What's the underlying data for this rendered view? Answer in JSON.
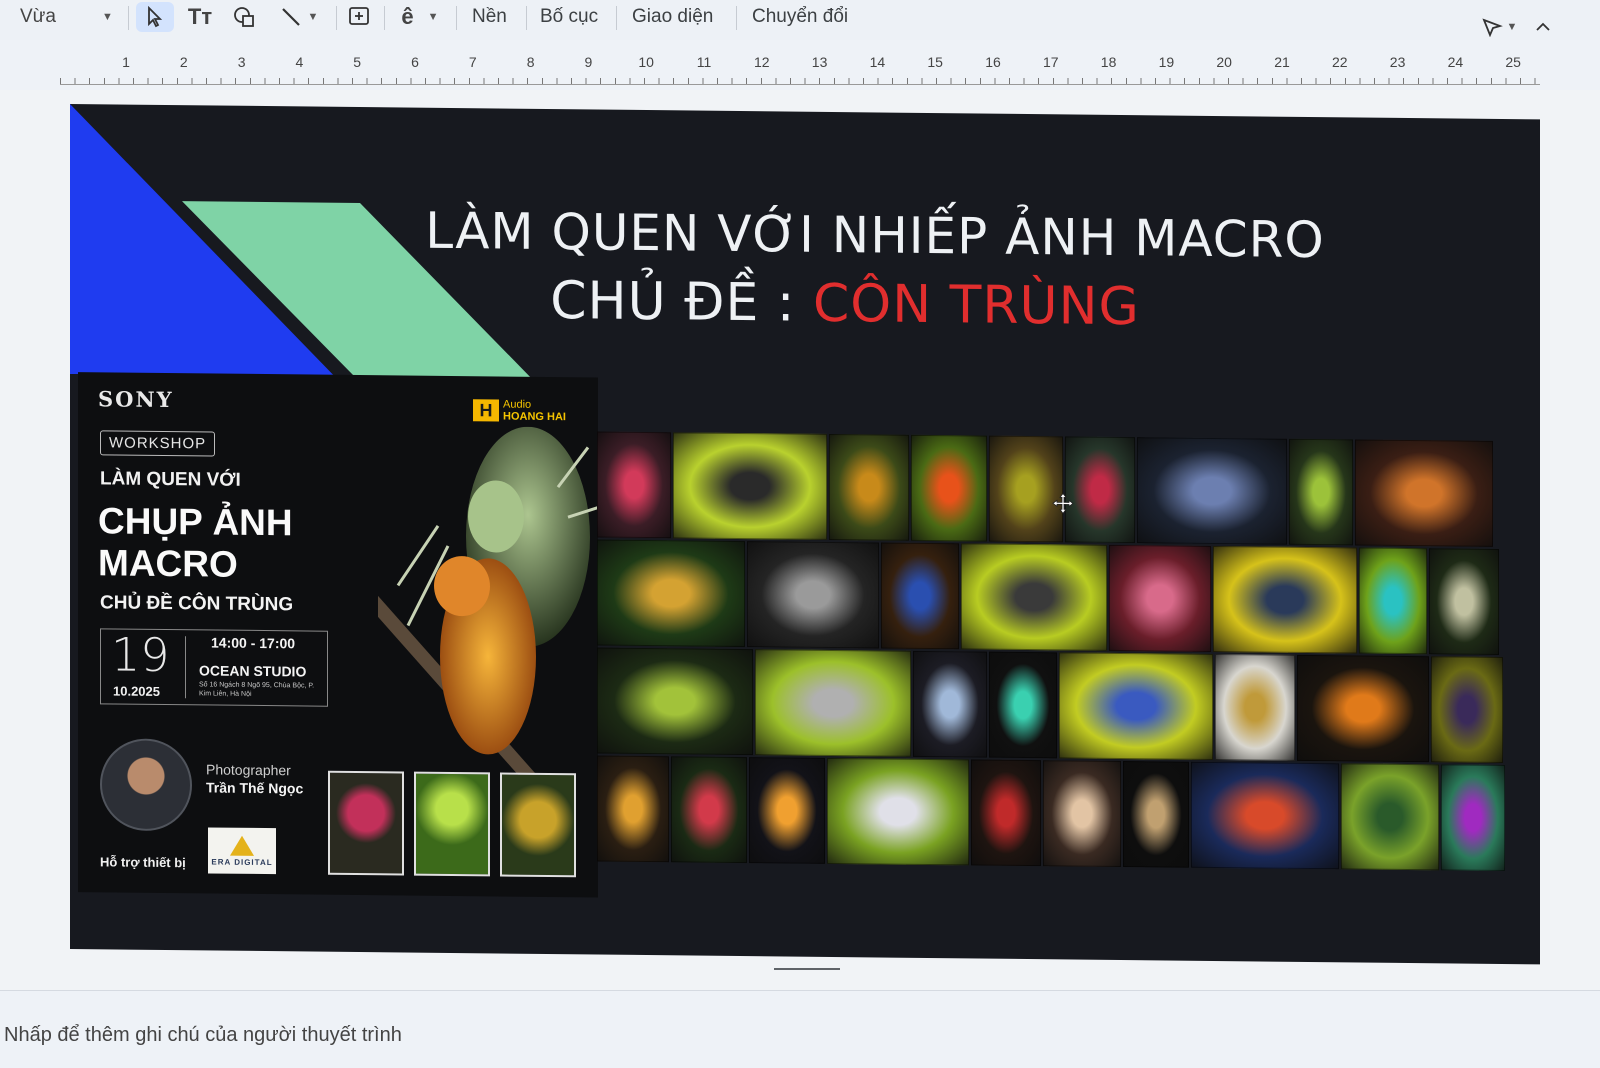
{
  "toolbar": {
    "zoom_label": "Vừa",
    "background_label": "Nền",
    "layout_label": "Bố cục",
    "theme_label": "Giao diện",
    "transition_label": "Chuyển đổi"
  },
  "ruler": {
    "marks": [
      "1",
      "2",
      "3",
      "4",
      "5",
      "6",
      "7",
      "8",
      "9",
      "10",
      "11",
      "12",
      "13",
      "14",
      "15",
      "16",
      "17",
      "18",
      "19",
      "20",
      "21",
      "22",
      "23",
      "24",
      "25"
    ]
  },
  "slide": {
    "title_line1": "LÀM QUEN VỚI NHIẾP ẢNH MACRO",
    "title_line2_prefix": "CHỦ ĐỀ : ",
    "title_line2_highlight": "CÔN TRÙNG",
    "accent_red": "#e12e2e",
    "stripe_blue": "#1f3cf0",
    "stripe_green": "#7fd3a6",
    "poster": {
      "brand": "SONY",
      "sponsor_sub": "Audio",
      "sponsor_name": "HOANG HAI",
      "badge": "WORKSHOP",
      "line1": "LÀM QUEN VỚI",
      "line2": "CHỤP ẢNH MACRO",
      "line3": "CHỦ ĐỀ CÔN TRÙNG",
      "day": "19",
      "month": "10.2025",
      "time": "14:00 - 17:00",
      "venue": "OCEAN STUDIO",
      "address": "Số 16 Ngách 8 Ngõ 95, Chùa Bộc, P. Kim Liên, Hà Nội",
      "role": "Photographer",
      "photographer": "Trần Thế Ngọc",
      "support_label": "Hỗ trợ thiết bị",
      "support_logo": "ERA DIGITAL"
    },
    "grid_tiles": [
      {
        "row": 0,
        "color": "#3b1d26",
        "accent": "#d23a5a"
      },
      {
        "row": 0,
        "color": "#b9d12e",
        "accent": "#2a2a2a"
      },
      {
        "row": 0,
        "color": "#3c4a18",
        "accent": "#c88a1a"
      },
      {
        "row": 0,
        "color": "#4a6a14",
        "accent": "#e8521a"
      },
      {
        "row": 0,
        "color": "#52421a",
        "accent": "#a6a020"
      },
      {
        "row": 0,
        "color": "#26362a",
        "accent": "#c02a46"
      },
      {
        "row": 0,
        "color": "#1b2230",
        "accent": "#6c7fb0"
      },
      {
        "row": 0,
        "color": "#26361a",
        "accent": "#9cc23a"
      },
      {
        "row": 0,
        "color": "#3a1e14",
        "accent": "#d0742a"
      },
      {
        "row": 1,
        "color": "#1e3a16",
        "accent": "#d4a232"
      },
      {
        "row": 1,
        "color": "#242424",
        "accent": "#9a9a9a"
      },
      {
        "row": 1,
        "color": "#35200e",
        "accent": "#2a4fb0"
      },
      {
        "row": 1,
        "color": "#b8cc22",
        "accent": "#3a3a3a"
      },
      {
        "row": 1,
        "color": "#6a1e2a",
        "accent": "#d86a8a"
      },
      {
        "row": 1,
        "color": "#d6c21a",
        "accent": "#2a3a5a"
      },
      {
        "row": 1,
        "color": "#6ea21a",
        "accent": "#2ac2c2"
      },
      {
        "row": 1,
        "color": "#1e2a16",
        "accent": "#c0c0a0"
      },
      {
        "row": 2,
        "color": "#1c2a14",
        "accent": "#a2c23a"
      },
      {
        "row": 2,
        "color": "#9cc02a",
        "accent": "#b0b0b0"
      },
      {
        "row": 2,
        "color": "#1c1c24",
        "accent": "#a0b8d8"
      },
      {
        "row": 2,
        "color": "#101010",
        "accent": "#3ad0b0"
      },
      {
        "row": 2,
        "color": "#c2cc22",
        "accent": "#3a5ac0"
      },
      {
        "row": 2,
        "color": "#d8d6cf",
        "accent": "#c09a3a"
      },
      {
        "row": 2,
        "color": "#1a140e",
        "accent": "#e07a1a"
      },
      {
        "row": 2,
        "color": "#6a6a14",
        "accent": "#3a2a5a"
      },
      {
        "row": 3,
        "color": "#2a1e12",
        "accent": "#e0a030"
      },
      {
        "row": 3,
        "color": "#1a2a14",
        "accent": "#d23a4a"
      },
      {
        "row": 3,
        "color": "#121218",
        "accent": "#f0a030"
      },
      {
        "row": 3,
        "color": "#7aa222",
        "accent": "#e0e0e8"
      },
      {
        "row": 3,
        "color": "#1e1410",
        "accent": "#c02a2a"
      },
      {
        "row": 3,
        "color": "#3a2a22",
        "accent": "#e2c4a4"
      },
      {
        "row": 3,
        "color": "#0e0e0e",
        "accent": "#c0a070"
      },
      {
        "row": 3,
        "color": "#1a2a5a",
        "accent": "#d84a2a"
      },
      {
        "row": 3,
        "color": "#7aa22a",
        "accent": "#2a5a2a"
      },
      {
        "row": 3,
        "color": "#2a7a5a",
        "accent": "#a02ac0"
      }
    ]
  },
  "notes": {
    "placeholder": "Nhấp để thêm ghi chú của người thuyết trình"
  }
}
